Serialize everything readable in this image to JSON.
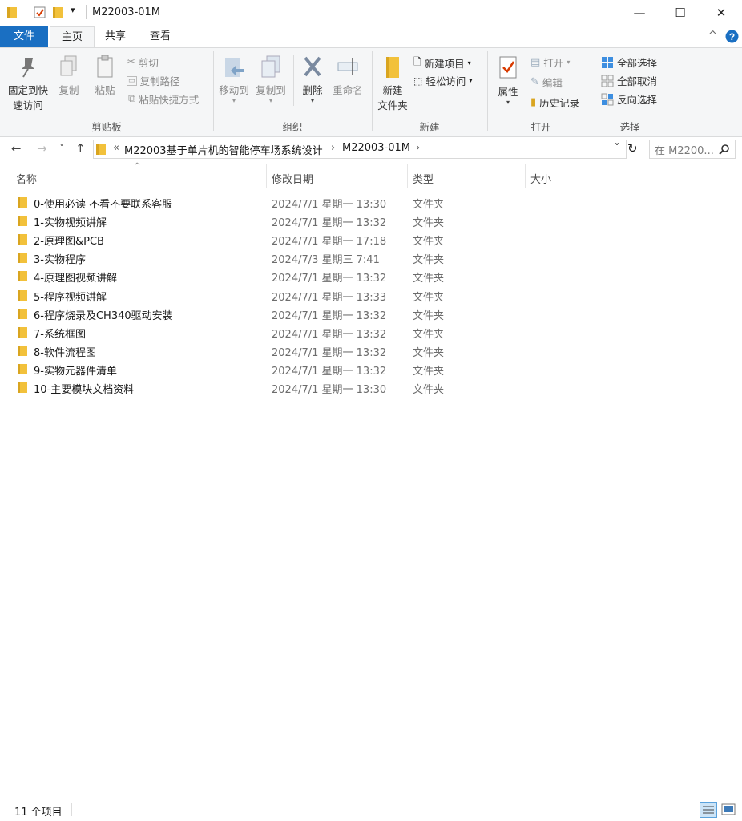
{
  "window": {
    "title": "M22003-01M",
    "quick_access_arrow": "▾",
    "minimize_glyph": "—",
    "maximize_glyph": "☐",
    "close_glyph": "✕"
  },
  "ribbon_tabs": {
    "file": "文件",
    "home": "主页",
    "share": "共享",
    "view": "查看"
  },
  "ribbon": {
    "clipboard": {
      "pin_line1": "固定到快",
      "pin_line2": "速访问",
      "copy": "复制",
      "paste": "粘贴",
      "cut": "剪切",
      "copy_path": "复制路径",
      "paste_shortcut": "粘贴快捷方式",
      "group_label": "剪贴板"
    },
    "organize": {
      "move_to": "移动到",
      "copy_to": "复制到",
      "delete": "删除",
      "rename": "重命名",
      "group_label": "组织"
    },
    "new": {
      "new_folder_line1": "新建",
      "new_folder_line2": "文件夹",
      "new_item": "新建项目",
      "easy_access": "轻松访问",
      "group_label": "新建"
    },
    "open": {
      "properties": "属性",
      "open": "打开",
      "edit": "编辑",
      "history": "历史记录",
      "group_label": "打开"
    },
    "select": {
      "select_all": "全部选择",
      "select_none": "全部取消",
      "invert": "反向选择",
      "group_label": "选择"
    }
  },
  "nav": {
    "back": "←",
    "forward": "→",
    "recent": "˅",
    "up": "↑",
    "overflow": "«",
    "breadcrumb_1": "M22003基于单片机的智能停车场系统设计",
    "breadcrumb_2": "M22003-01M",
    "sep": "›",
    "dropdown": "˅",
    "refresh": "↻",
    "search_placeholder": "在 M2200...",
    "search_glyph": "⚲"
  },
  "columns": {
    "name": "名称",
    "sort_glyph": "^",
    "date": "修改日期",
    "type": "类型",
    "size": "大小"
  },
  "files": [
    {
      "name": "0-使用必读  不看不要联系客服",
      "date": "2024/7/1 星期一 13:30",
      "type": "文件夹"
    },
    {
      "name": "1-实物视频讲解",
      "date": "2024/7/1 星期一 13:32",
      "type": "文件夹"
    },
    {
      "name": "2-原理图&PCB",
      "date": "2024/7/1 星期一 17:18",
      "type": "文件夹"
    },
    {
      "name": "3-实物程序",
      "date": "2024/7/3 星期三 7:41",
      "type": "文件夹"
    },
    {
      "name": "4-原理图视频讲解",
      "date": "2024/7/1 星期一 13:32",
      "type": "文件夹"
    },
    {
      "name": "5-程序视频讲解",
      "date": "2024/7/1 星期一 13:33",
      "type": "文件夹"
    },
    {
      "name": "6-程序烧录及CH340驱动安装",
      "date": "2024/7/1 星期一 13:32",
      "type": "文件夹"
    },
    {
      "name": "7-系统框图",
      "date": "2024/7/1 星期一 13:32",
      "type": "文件夹"
    },
    {
      "name": "8-软件流程图",
      "date": "2024/7/1 星期一 13:32",
      "type": "文件夹"
    },
    {
      "name": "9-实物元器件清单",
      "date": "2024/7/1 星期一 13:32",
      "type": "文件夹"
    },
    {
      "name": "10-主要模块文档资料",
      "date": "2024/7/1 星期一 13:30",
      "type": "文件夹"
    }
  ],
  "status": {
    "item_count": "11 个项目"
  },
  "colors": {
    "file_tab": "#1a6fc2",
    "ribbon_bg": "#f5f6f7",
    "folder": "#f2c13b",
    "help": "#1a6fc2"
  }
}
